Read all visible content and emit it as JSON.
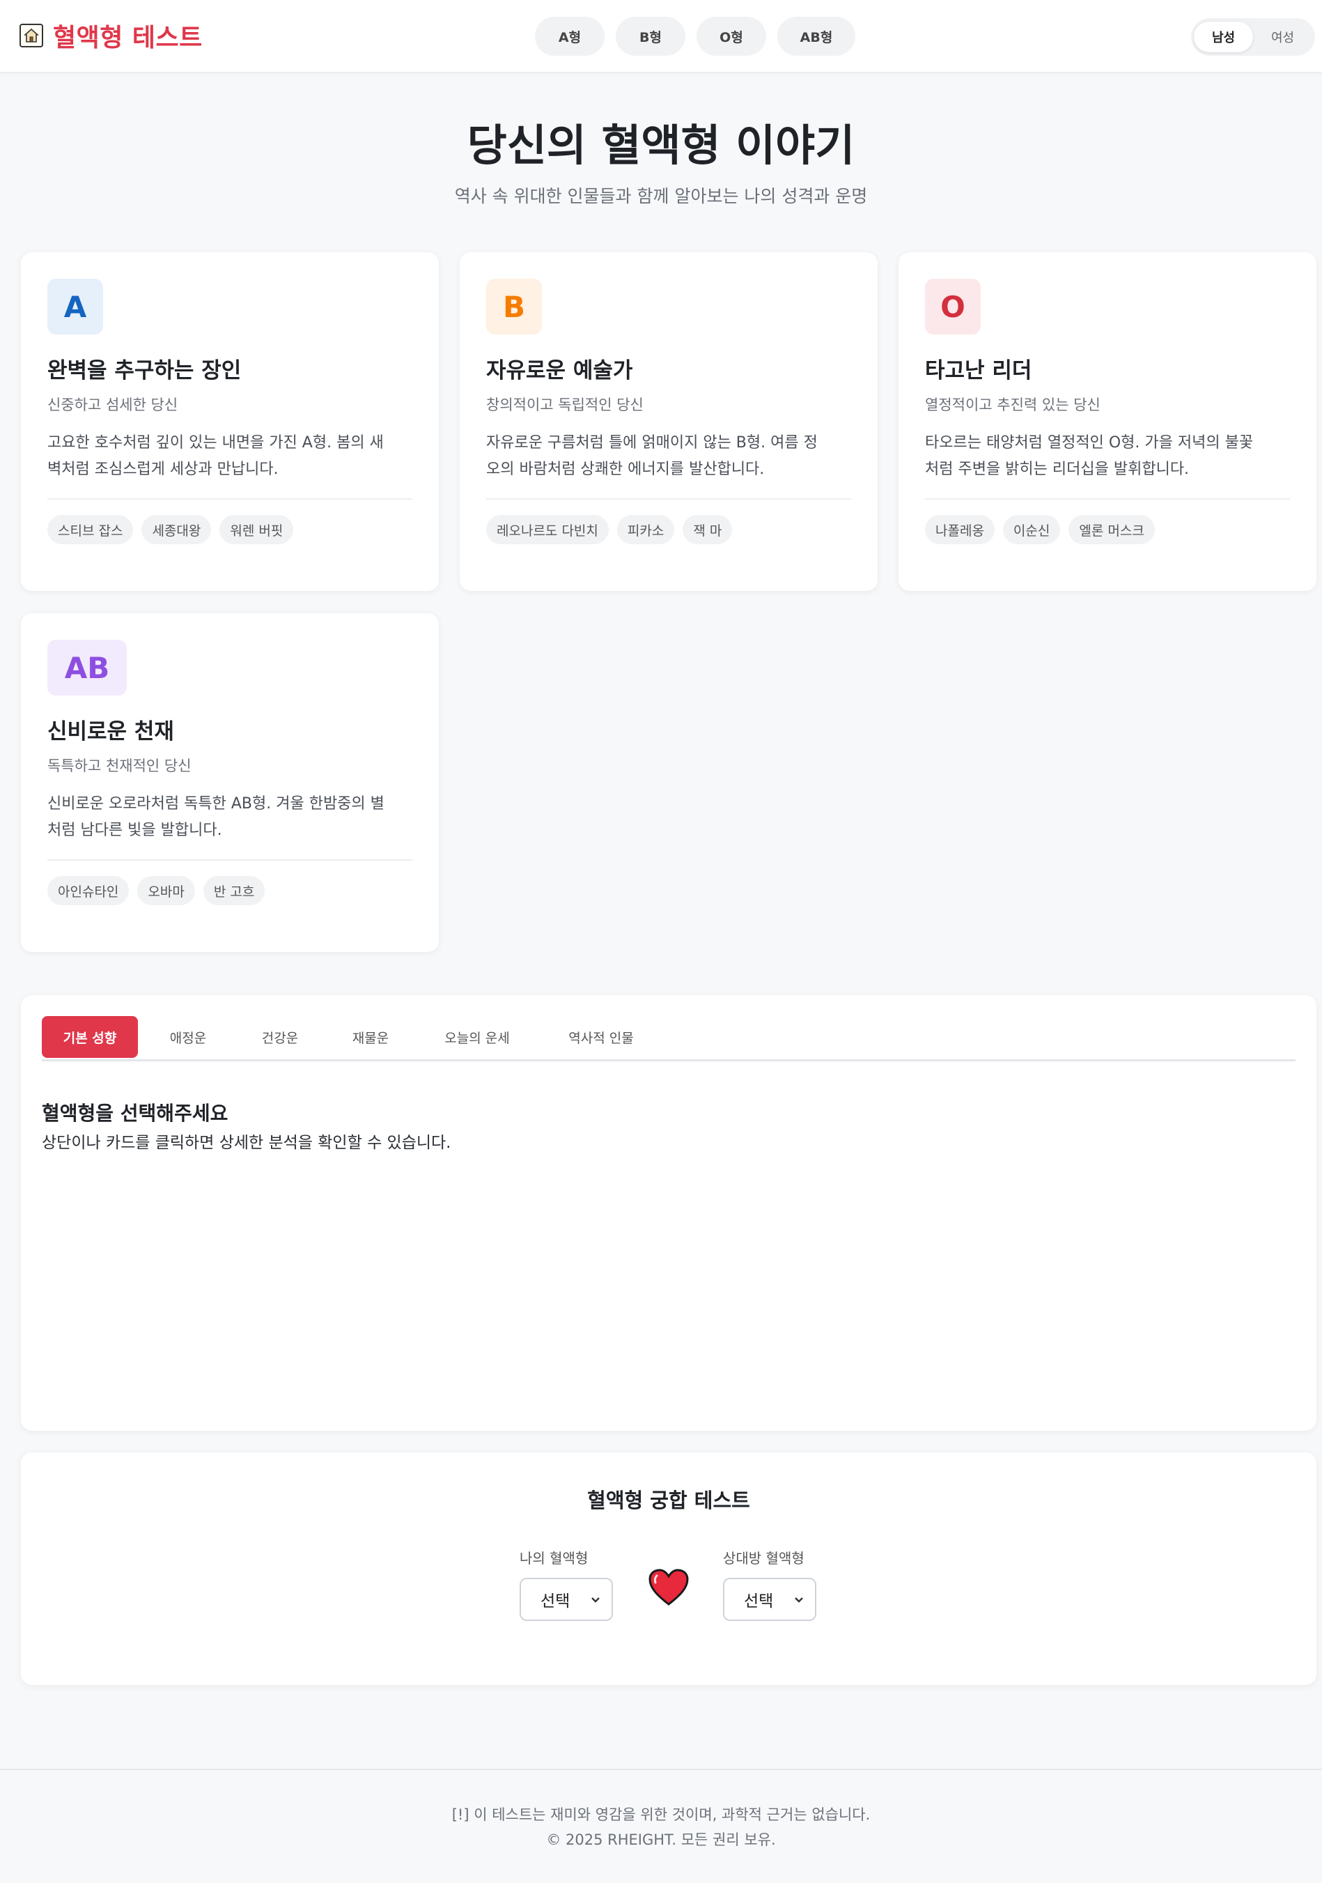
{
  "header": {
    "logo_icon": "house-icon",
    "logo_text": "혈액형 테스트",
    "nav": [
      "A형",
      "B형",
      "O형",
      "AB형"
    ],
    "gender": [
      "남성",
      "여성"
    ],
    "gender_selected": "남성"
  },
  "hero": {
    "title": "당신의 혈액형 이야기",
    "subtitle": "역사 속 위대한 인물들과 함께 알아보는 나의 성격과 운명"
  },
  "cards": [
    {
      "badge": "A",
      "badge_color": "#1565c0",
      "badge_bg": "#e6f0fb",
      "title": "완벽을 추구하는 장인",
      "subtitle": "신중하고 섬세한 당신",
      "desc_line1": "고요한 호수처럼 깊이 있는 내면을 가진 A형. 봄의 새",
      "desc_line2": "벽처럼 조심스럽게 세상과 만납니다.",
      "tags": [
        "스티브 잡스",
        "세종대왕",
        "워렌 버핏"
      ]
    },
    {
      "badge": "B",
      "badge_color": "#f57c00",
      "badge_bg": "#fff1e3",
      "title": "자유로운 예술가",
      "subtitle": "창의적이고 독립적인 당신",
      "desc_line1": "자유로운 구름처럼 틀에 얽매이지 않는 B형. 여름 정",
      "desc_line2": "오의 바람처럼 상쾌한 에너지를 발산합니다.",
      "tags": [
        "레오나르도 다빈치",
        "피카소",
        "잭 마"
      ]
    },
    {
      "badge": "O",
      "badge_color": "#d32f3f",
      "badge_bg": "#fce8ea",
      "title": "타고난 리더",
      "subtitle": "열정적이고 추진력 있는 당신",
      "desc_line1": "타오르는 태양처럼 열정적인 O형. 가을 저녁의 불꽃",
      "desc_line2": "처럼 주변을 밝히는 리더십을 발휘합니다.",
      "tags": [
        "나폴레옹",
        "이순신",
        "엘론 머스크"
      ]
    },
    {
      "badge": "AB",
      "badge_color": "#8e4fe0",
      "badge_bg": "#f2eafd",
      "title": "신비로운 천재",
      "subtitle": "독특하고 천재적인 당신",
      "desc_line1": "신비로운 오로라처럼 독특한 AB형. 겨울 한밤중의 별",
      "desc_line2": "처럼 남다른 빛을 발합니다.",
      "tags": [
        "아인슈타인",
        "오바마",
        "반 고흐"
      ]
    }
  ],
  "tabs": {
    "items": [
      "기본 성향",
      "애정운",
      "건강운",
      "재물운",
      "오늘의 운세",
      "역사적 인물"
    ],
    "active": "기본 성향",
    "accent": "#e0374a"
  },
  "panel": {
    "heading": "혈액형을 선택해주세요",
    "text": "상단이나 카드를 클릭하면 상세한 분석을 확인할 수 있습니다."
  },
  "compat": {
    "title": "혈액형 궁합 테스트",
    "my_label": "나의 혈액형",
    "partner_label": "상대방 혈액형",
    "my_value": "선택",
    "partner_value": "선택",
    "heart_icon": "heart-icon"
  },
  "footer": {
    "line1": "[!] 이 테스트는 재미와 영감을 위한 것이며, 과학적 근거는 없습니다.",
    "line2": "© 2025 RHEIGHT. 모든 권리 보유."
  }
}
